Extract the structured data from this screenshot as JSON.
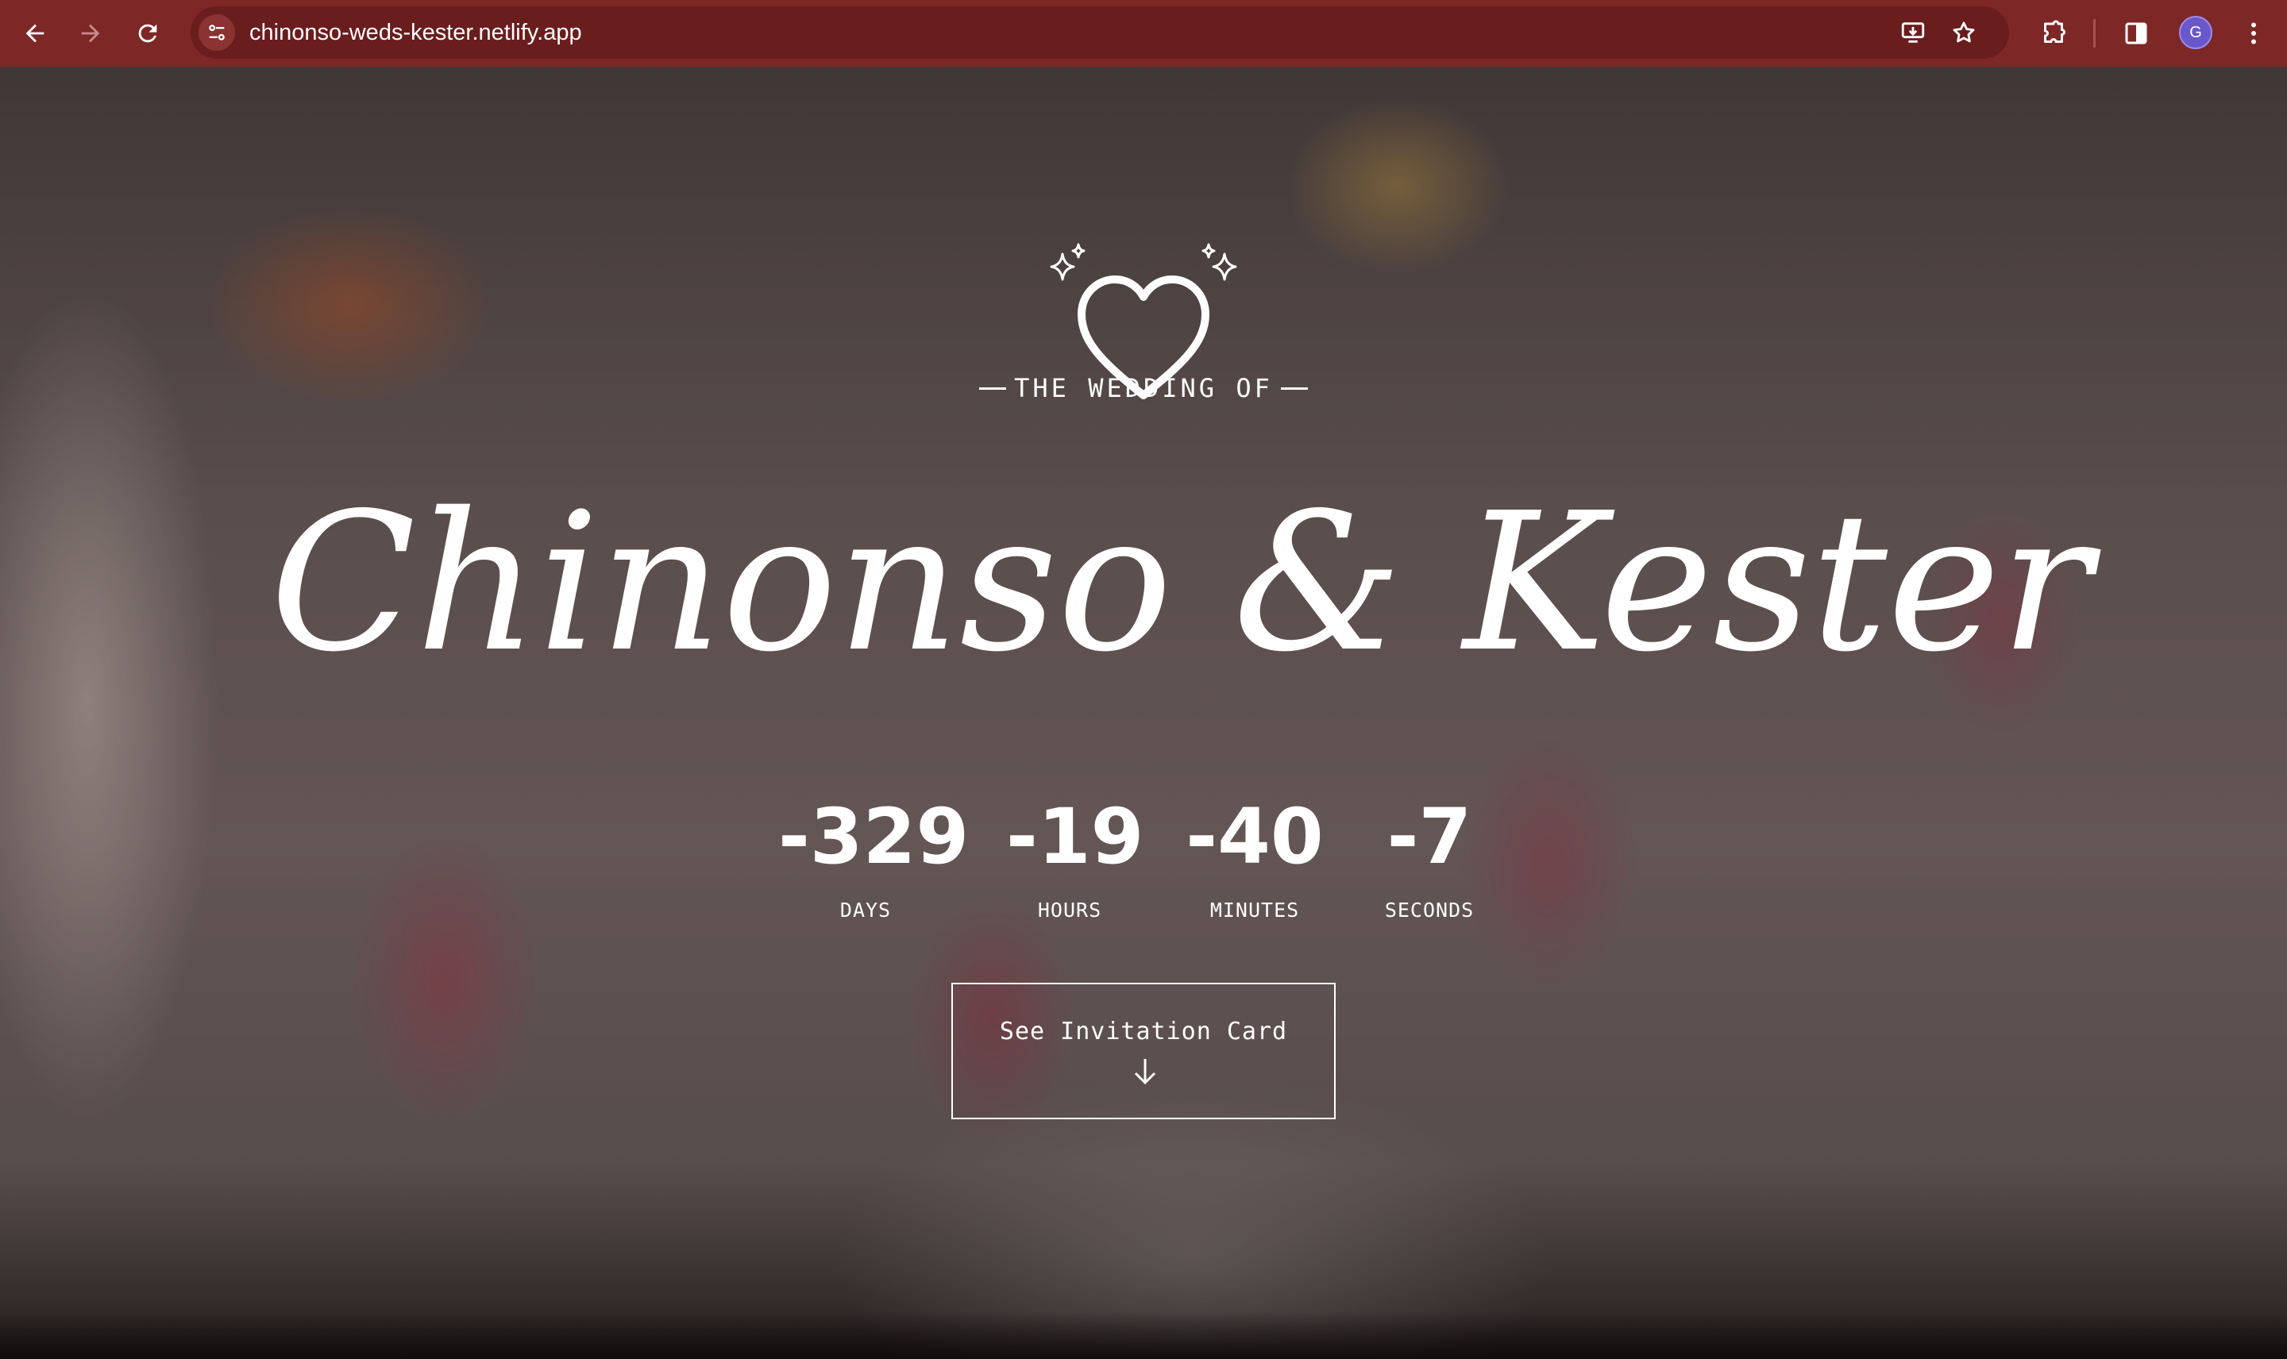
{
  "browser": {
    "url": "chinonso-weds-kester.netlify.app",
    "avatar_initial": "G",
    "theme_color": "#7e2727",
    "icons": {
      "back": "arrow-left-icon",
      "forward": "arrow-right-icon",
      "reload": "reload-icon",
      "site_info": "tune-icon",
      "install": "install-app-icon",
      "bookmark": "star-icon",
      "extensions": "puzzle-icon",
      "side_panel": "side-panel-icon",
      "menu": "kebab-menu-icon"
    }
  },
  "hero": {
    "subtitle": "THE WEDDING OF",
    "names": "Chinonso & Kester",
    "emblem_icon": "heart-sparkles-icon"
  },
  "countdown": [
    {
      "value": "-329",
      "label": "DAYS"
    },
    {
      "value": "-19",
      "label": "HOURS"
    },
    {
      "value": "-40",
      "label": "MINUTES"
    },
    {
      "value": "-7",
      "label": "SECONDS"
    }
  ],
  "cta": {
    "label": "See Invitation Card",
    "icon": "arrow-down-icon"
  }
}
